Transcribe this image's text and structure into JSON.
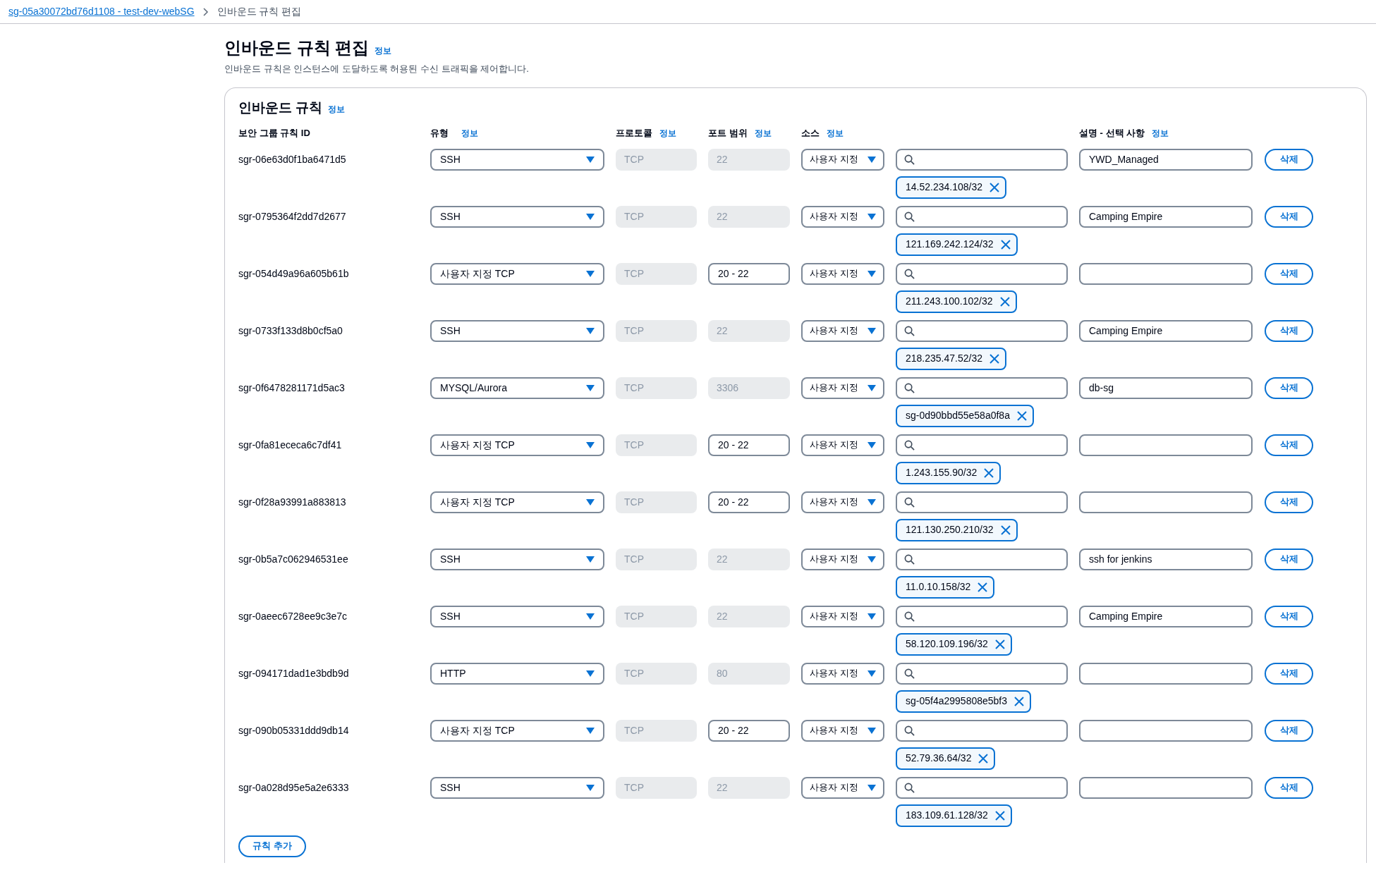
{
  "breadcrumb": {
    "link": "sg-05a30072bd76d1108 - test-dev-webSG",
    "current": "인바운드 규칙 편집"
  },
  "page": {
    "title": "인바운드 규칙 편집",
    "info": "정보",
    "description": "인바운드 규칙은 인스턴스에 도달하도록 허용된 수신 트래픽을 제어합니다."
  },
  "panel": {
    "title": "인바운드 규칙",
    "info": "정보"
  },
  "columns": [
    {
      "label": "보안 그룹 규칙 ID"
    },
    {
      "label": "유형",
      "info": "정보"
    },
    {
      "label": "프로토콜",
      "info": "정보"
    },
    {
      "label": "포트 범위",
      "info": "정보"
    },
    {
      "label": "소스",
      "info": "정보"
    },
    {
      "label": "설명 - 선택 사항",
      "info": "정보"
    }
  ],
  "rules": [
    {
      "id": "sgr-06e63d0f1ba6471d5",
      "type": "SSH",
      "protocol": "TCP",
      "port": "22",
      "port_disabled": true,
      "source": "사용자 지정",
      "chip": "14.52.234.108/32",
      "description": "YWD_Managed",
      "delete": "삭제"
    },
    {
      "id": "sgr-0795364f2dd7d2677",
      "type": "SSH",
      "protocol": "TCP",
      "port": "22",
      "port_disabled": true,
      "source": "사용자 지정",
      "chip": "121.169.242.124/32",
      "description": "Camping Empire",
      "delete": "삭제"
    },
    {
      "id": "sgr-054d49a96a605b61b",
      "type": "사용자 지정 TCP",
      "protocol": "TCP",
      "port": "20 - 22",
      "port_disabled": false,
      "source": "사용자 지정",
      "chip": "211.243.100.102/32",
      "delete": "삭제"
    },
    {
      "id": "sgr-0733f133d8b0cf5a0",
      "type": "SSH",
      "protocol": "TCP",
      "port": "22",
      "port_disabled": true,
      "source": "사용자 지정",
      "chip": "218.235.47.52/32",
      "description": "Camping Empire",
      "delete": "삭제"
    },
    {
      "id": "sgr-0f6478281171d5ac3",
      "type": "MYSQL/Aurora",
      "protocol": "TCP",
      "port": "3306",
      "port_disabled": true,
      "source": "사용자 지정",
      "chip": "sg-0d90bbd55e58a0f8a",
      "description": "db-sg",
      "delete": "삭제"
    },
    {
      "id": "sgr-0fa81ececa6c7df41",
      "type": "사용자 지정 TCP",
      "protocol": "TCP",
      "port": "20 - 22",
      "port_disabled": false,
      "source": "사용자 지정",
      "chip": "1.243.155.90/32",
      "delete": "삭제"
    },
    {
      "id": "sgr-0f28a93991a883813",
      "type": "사용자 지정 TCP",
      "protocol": "TCP",
      "port": "20 - 22",
      "port_disabled": false,
      "source": "사용자 지정",
      "chip": "121.130.250.210/32",
      "delete": "삭제"
    },
    {
      "id": "sgr-0b5a7c062946531ee",
      "type": "SSH",
      "protocol": "TCP",
      "port": "22",
      "port_disabled": true,
      "source": "사용자 지정",
      "chip": "11.0.10.158/32",
      "description": "ssh for jenkins",
      "delete": "삭제"
    },
    {
      "id": "sgr-0aeec6728ee9c3e7c",
      "type": "SSH",
      "protocol": "TCP",
      "port": "22",
      "port_disabled": true,
      "source": "사용자 지정",
      "chip": "58.120.109.196/32",
      "description": "Camping Empire",
      "delete": "삭제"
    },
    {
      "id": "sgr-094171dad1e3bdb9d",
      "type": "HTTP",
      "protocol": "TCP",
      "port": "80",
      "port_disabled": true,
      "source": "사용자 지정",
      "chip": "sg-05f4a2995808e5bf3",
      "delete": "삭제"
    },
    {
      "id": "sgr-090b05331ddd9db14",
      "type": "사용자 지정 TCP",
      "protocol": "TCP",
      "port": "20 - 22",
      "port_disabled": false,
      "source": "사용자 지정",
      "chip": "52.79.36.64/32",
      "delete": "삭제"
    },
    {
      "id": "sgr-0a028d95e5a2e6333",
      "type": "SSH",
      "protocol": "TCP",
      "port": "22",
      "port_disabled": true,
      "source": "사용자 지정",
      "chip": "183.109.61.128/32",
      "delete": "삭제"
    }
  ],
  "add_button": "규칙 추가"
}
